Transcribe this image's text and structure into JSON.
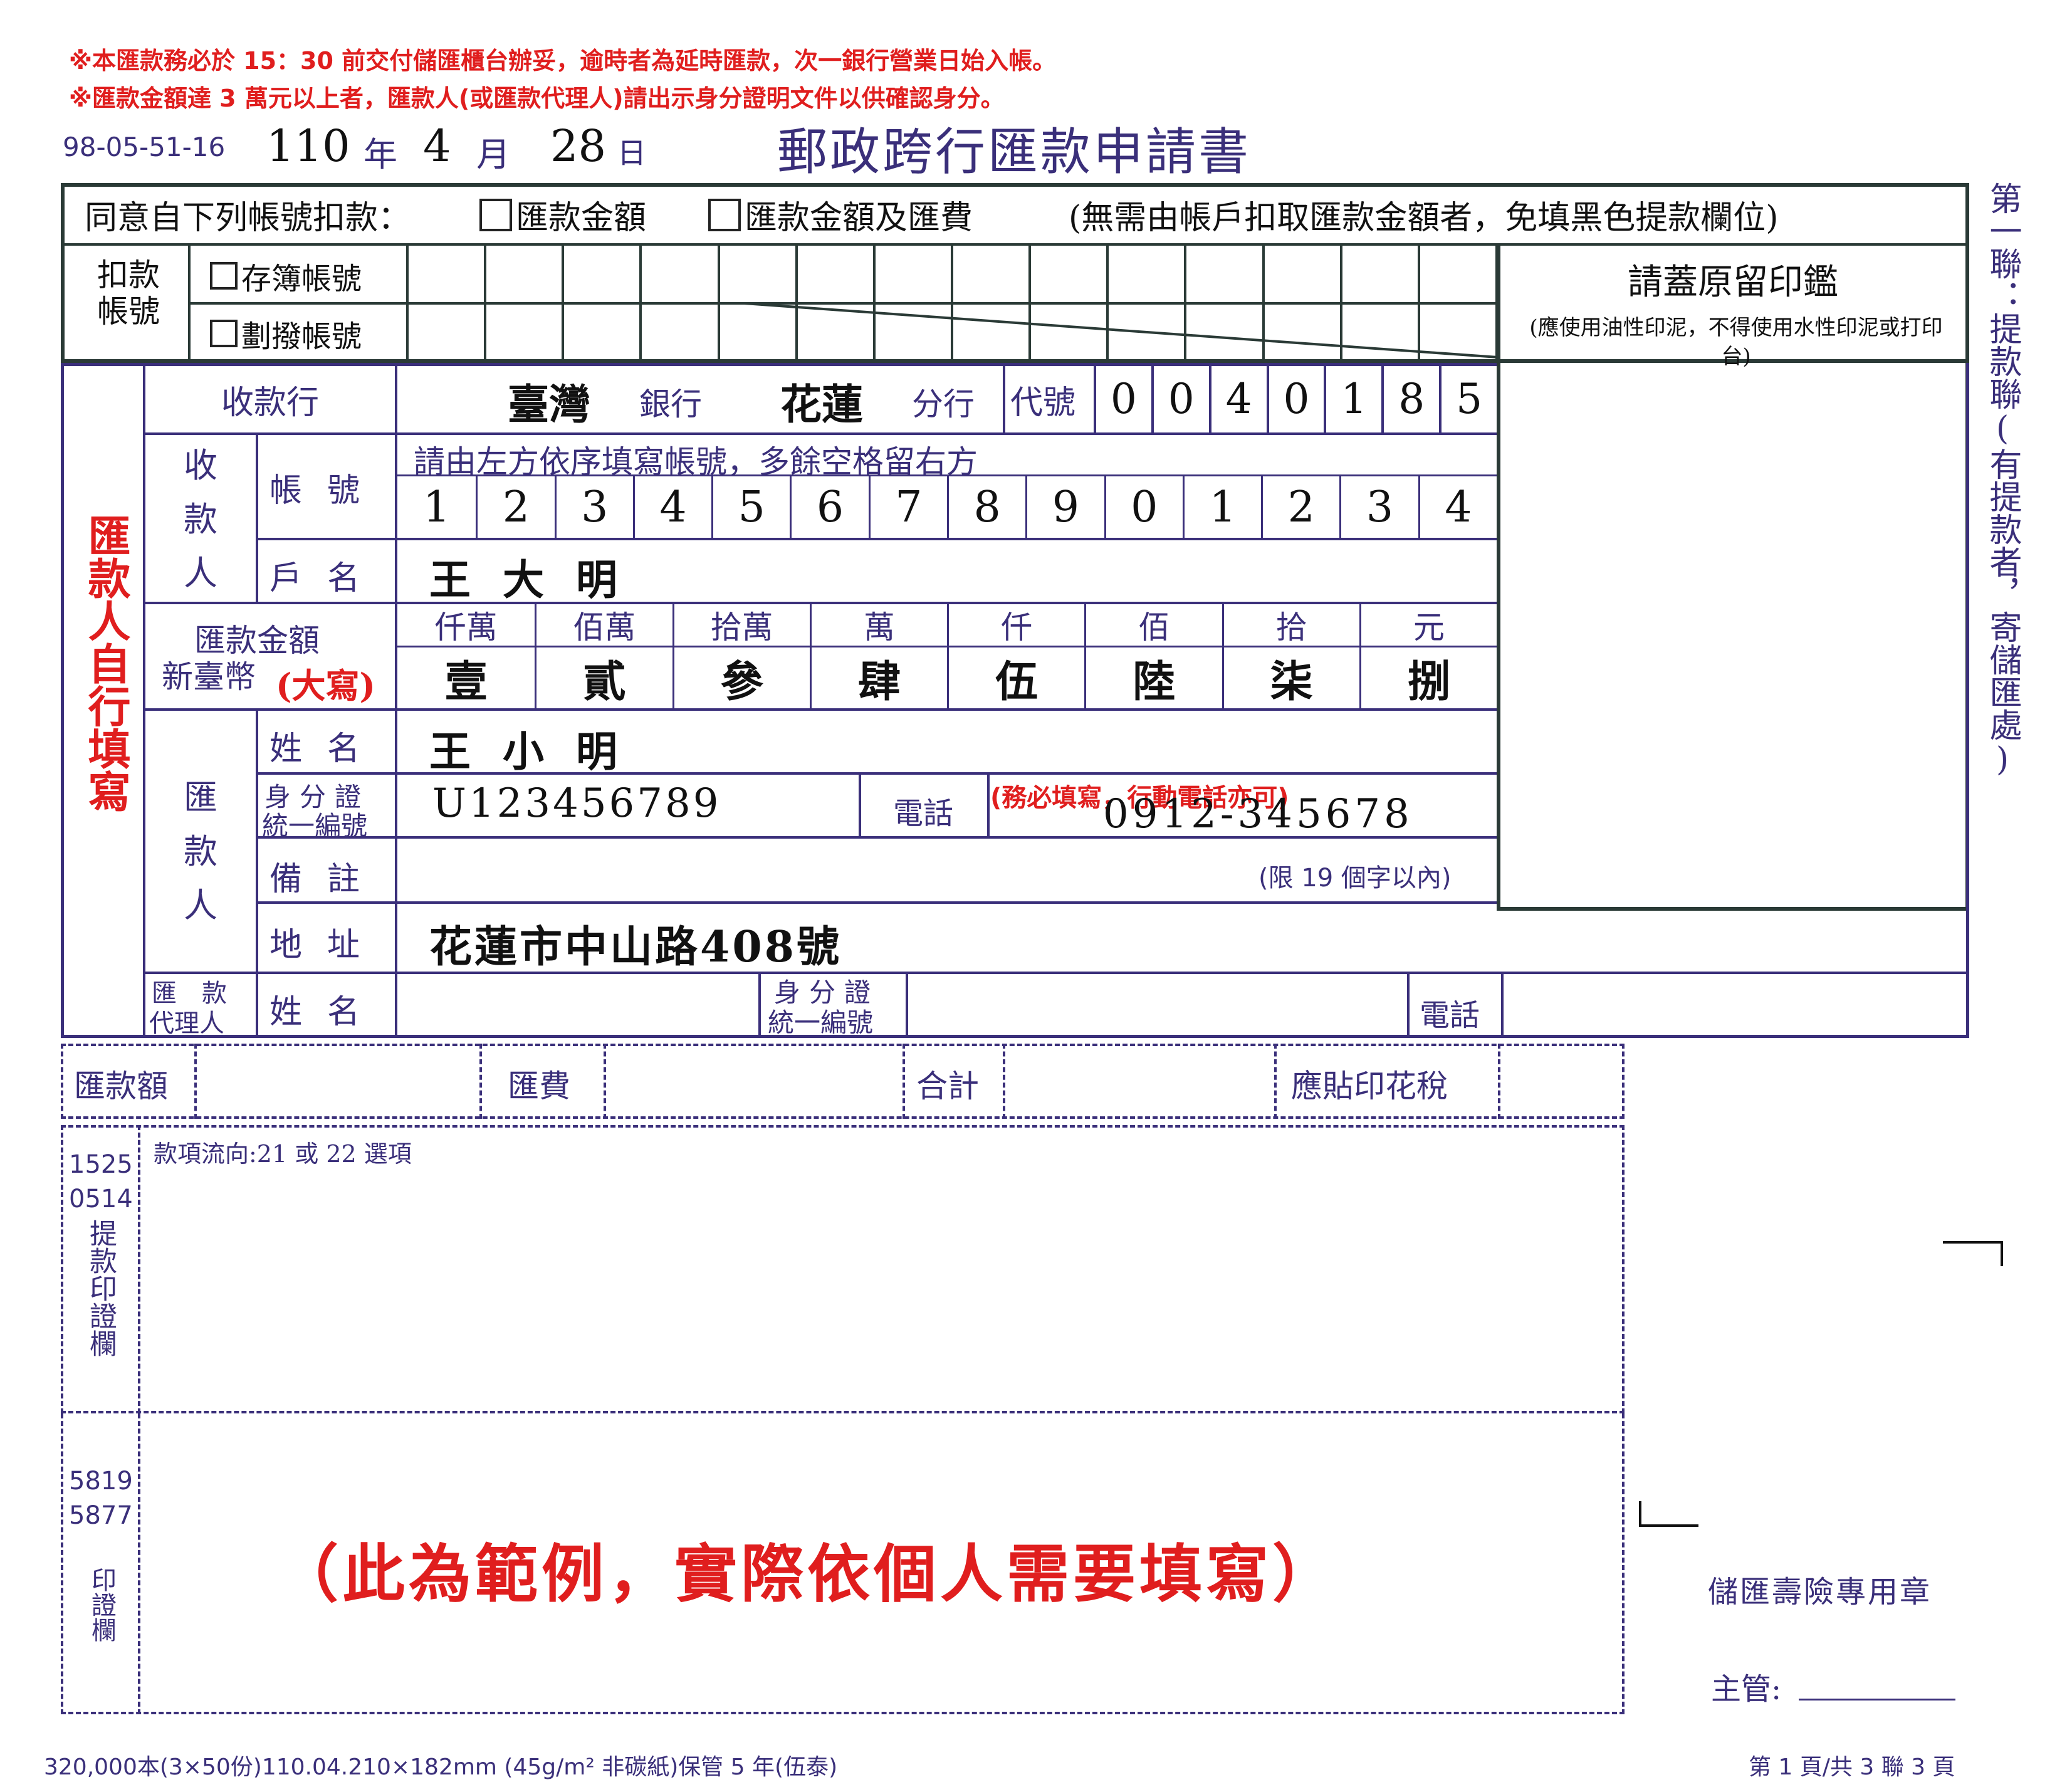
{
  "notices": {
    "line1": "※本匯款務必於 15：30 前交付儲匯櫃台辦妥，逾時者為延時匯款，次一銀行營業日始入帳。",
    "line2": "※匯款金額達 3 萬元以上者，匯款人(或匯款代理人)請出示身分證明文件以供確認身分。"
  },
  "header": {
    "form_code": "98-05-51-16",
    "year": "110",
    "year_label": "年",
    "month": "4",
    "month_label": "月",
    "day": "28",
    "day_label": "日",
    "title": "郵政跨行匯款申請書"
  },
  "side_label": "第一聯：提款聯(有提款者，寄儲匯處)",
  "deduct": {
    "consent": "同意自下列帳號扣款：",
    "opt_amount": "匯款金額",
    "opt_amount_fee": "匯款金額及匯費",
    "note": "(無需由帳戶扣取匯款金額者，免填黑色提款欄位)",
    "account_label": "扣款帳號",
    "passbook": "存簿帳號",
    "transfer": "劃撥帳號",
    "seal_title": "請蓋原留印鑑",
    "seal_note": "(應使用油性印泥，不得使用水性印泥或打印台)"
  },
  "left_label": "匯款人自行填寫",
  "payee_bank": {
    "label": "收款行",
    "bank": "臺灣",
    "bank_suffix": "銀行",
    "branch": "花蓮",
    "branch_suffix": "分行",
    "code_label": "代號",
    "code_digits": [
      "0",
      "0",
      "4",
      "0",
      "1",
      "8",
      "5"
    ]
  },
  "payee": {
    "label": "收款人",
    "account_label": "帳號",
    "account_hint": "請由左方依序填寫帳號，多餘空格留右方",
    "account_digits": [
      "1",
      "2",
      "3",
      "4",
      "5",
      "6",
      "7",
      "8",
      "9",
      "0",
      "1",
      "2",
      "3",
      "4"
    ],
    "name_label": "戶名",
    "name": "王 大 明"
  },
  "amount": {
    "label1": "匯款金額",
    "label2": "新臺幣",
    "label3": "(大寫)",
    "units": [
      "仟萬",
      "佰萬",
      "拾萬",
      "萬",
      "仟",
      "佰",
      "拾",
      "元"
    ],
    "values": [
      "壹",
      "貳",
      "參",
      "肆",
      "伍",
      "陸",
      "柒",
      "捌"
    ]
  },
  "remitter": {
    "label": "匯款人",
    "name_label": "姓名",
    "name": "王 小 明",
    "id_label1": "身分證",
    "id_label2": "統一編號",
    "id": "U123456789",
    "phone_label": "電話",
    "phone_note": "(務必填寫，行動電話亦可)",
    "phone": "0912-345678",
    "memo_label": "備註",
    "memo_limit": "(限 19 個字以內)",
    "address_label": "地址",
    "address": "花蓮市中山路408號"
  },
  "agent": {
    "label1": "匯款",
    "label2": "代理人",
    "name_label": "姓名",
    "id_label1": "身分證",
    "id_label2": "統一編號",
    "phone_label": "電話"
  },
  "totals": {
    "remit": "匯款額",
    "fee": "匯費",
    "sum": "合計",
    "stamp_tax": "應貼印花稅"
  },
  "lower": {
    "code1a": "1525",
    "code1b": "0514",
    "seal_label1": "提款印證欄",
    "flow_note": "款項流向:21 或 22 選項",
    "code2a": "5819",
    "code2b": "5877",
    "seal_label2": "印證欄",
    "example": "（此為範例，實際依個人需要填寫）"
  },
  "right": {
    "stamp_label": "儲匯壽險專用章",
    "supervisor": "主管:"
  },
  "footer": {
    "left": "320,000本(3×50份)110.04.210×182mm (45g/m² 非碳紙)保管 5 年(伍泰)",
    "right": "第 1 頁/共 3 聯 3 頁"
  },
  "colors": {
    "form_ink": "#3a2f7a",
    "black_frame": "#2a3a36",
    "notice_red": "#e01e1e"
  }
}
